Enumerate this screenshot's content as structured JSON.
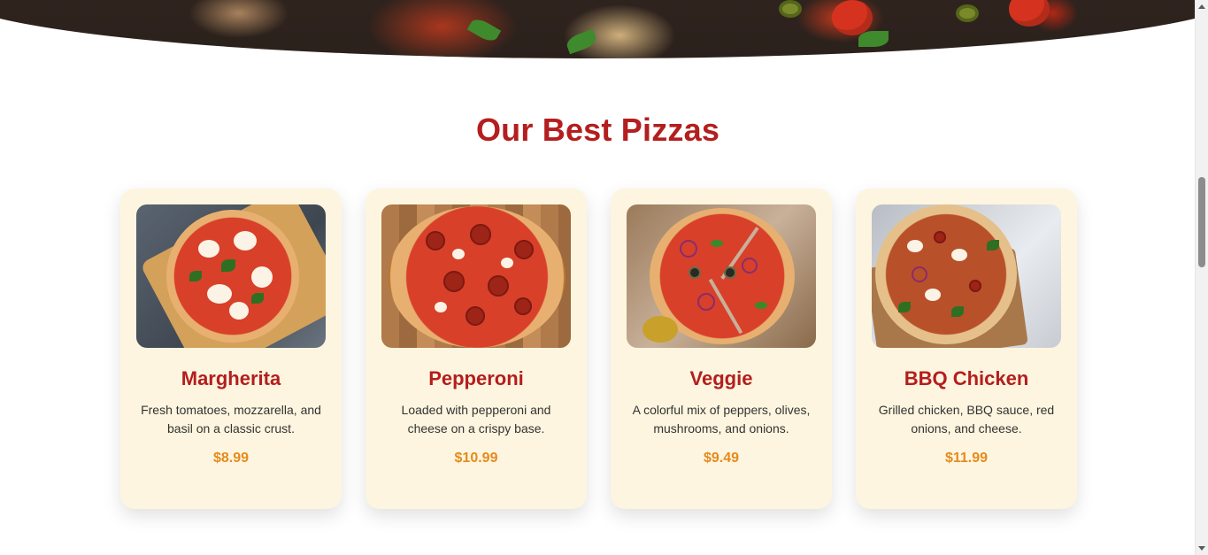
{
  "section": {
    "title": "Our Best Pizzas"
  },
  "pizzas": [
    {
      "name": "Margherita",
      "description": "Fresh tomatoes, mozzarella, and basil on a classic crust.",
      "price": "$8.99",
      "image_icon": "margherita-pizza-image"
    },
    {
      "name": "Pepperoni",
      "description": "Loaded with pepperoni and cheese on a crispy base.",
      "price": "$10.99",
      "image_icon": "pepperoni-pizza-image"
    },
    {
      "name": "Veggie",
      "description": "A colorful mix of peppers, olives, mushrooms, and onions.",
      "price": "$9.49",
      "image_icon": "veggie-pizza-image"
    },
    {
      "name": "BBQ Chicken",
      "description": "Grilled chicken, BBQ sauce, red onions, and cheese.",
      "price": "$11.99",
      "image_icon": "bbq-chicken-pizza-image"
    }
  ],
  "colors": {
    "title": "#b41e1e",
    "price": "#e58a1c",
    "card_background": "#fdf5df"
  }
}
